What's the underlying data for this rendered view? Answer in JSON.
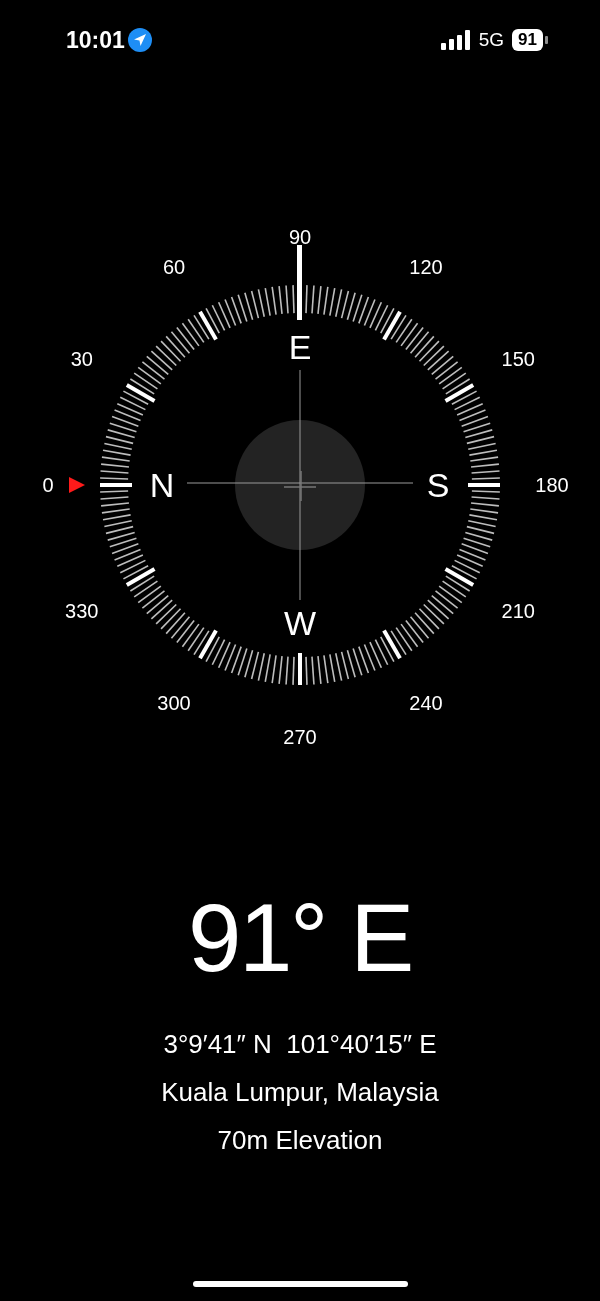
{
  "status_bar": {
    "time": "10:01",
    "network": "5G",
    "battery": "91"
  },
  "compass": {
    "dial_numbers": [
      "0",
      "30",
      "60",
      "90",
      "120",
      "150",
      "180",
      "210",
      "240",
      "270",
      "300",
      "330"
    ],
    "cardinals": [
      "N",
      "E",
      "S",
      "W"
    ]
  },
  "reading": {
    "heading": "91° E",
    "coordinates": "3°9′41″ N  101°40′15″ E",
    "location": "Kuala Lumpur, Malaysia",
    "elevation": "70m Elevation"
  }
}
